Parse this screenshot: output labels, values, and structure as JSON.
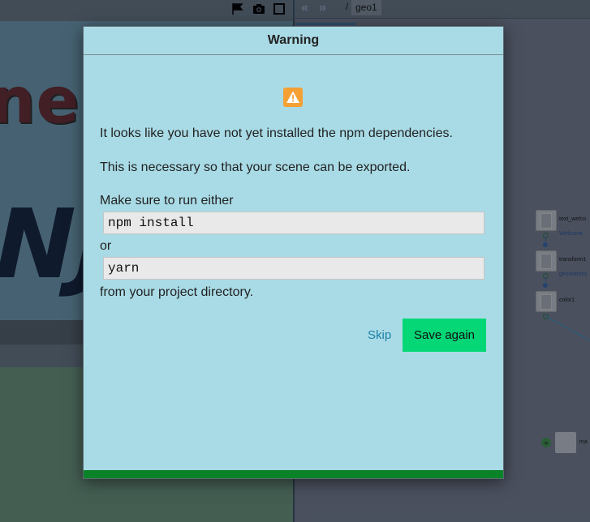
{
  "graph_header": {
    "back_arrow": "«",
    "forward_arrow": "»",
    "breadcrumb_separator": "/",
    "breadcrumb_item": "geo1"
  },
  "viewport": {
    "scene_text_top": "ne",
    "scene_text_bottom": "NJ",
    "icons": [
      "flag-icon",
      "camera-icon",
      "square-icon"
    ]
  },
  "nodes": [
    {
      "name": "text_welco",
      "sub": "Welcome"
    },
    {
      "name": "transform1",
      "sub": "geometries"
    },
    {
      "name": "color1",
      "sub": ""
    }
  ],
  "node_m_label": "ma",
  "modal": {
    "title": "Warning",
    "icon": "warning-icon",
    "line1": "It looks like you have not yet installed the npm dependencies.",
    "line2": "This is necessary so that your scene can be exported.",
    "line3": "Make sure to run either",
    "command1": "npm install",
    "or": "or",
    "command2": "yarn",
    "line4": "from your project directory.",
    "skip_label": "Skip",
    "save_label": "Save again",
    "progress": 1.0,
    "colors": {
      "accent": "#05d676",
      "progress": "#0a8227",
      "link": "#1a7fa8",
      "warning": "#f5a033"
    }
  }
}
